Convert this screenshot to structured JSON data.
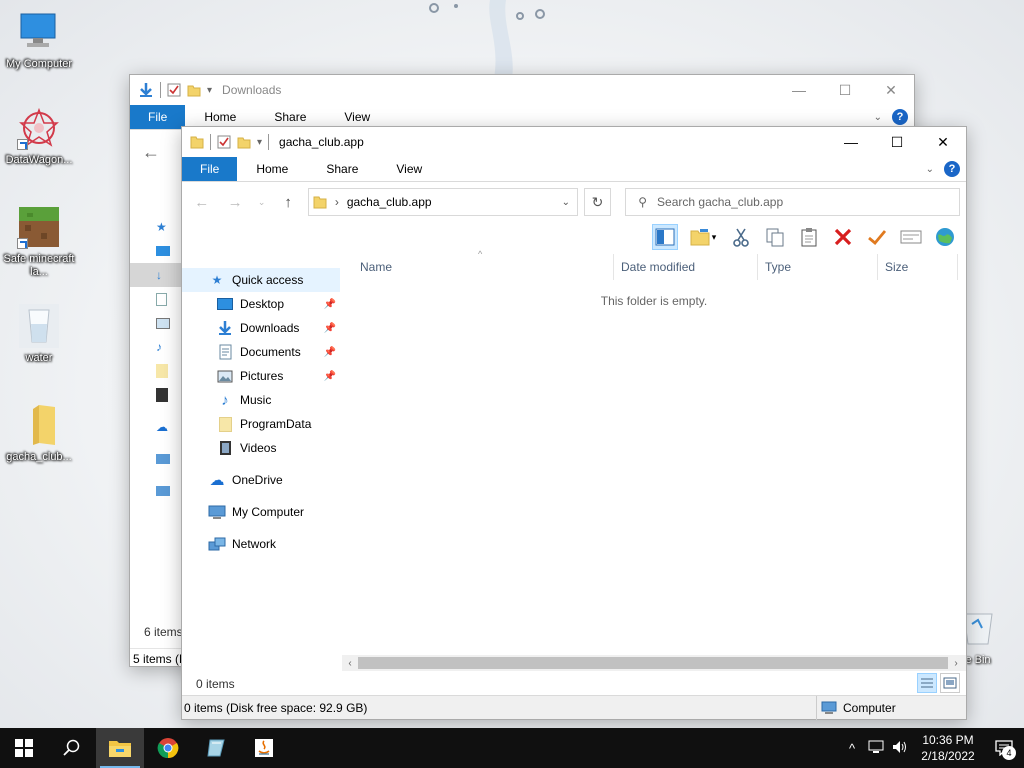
{
  "desktop": {
    "icons": [
      {
        "label": "My Computer",
        "icon": "monitor-icon"
      },
      {
        "label": "DataWagon...",
        "icon": "datawagon-icon"
      },
      {
        "label": "Safe minecraft la...",
        "icon": "minecraft-icon"
      },
      {
        "label": "water",
        "icon": "water-glass-icon"
      },
      {
        "label": "gacha_club...",
        "icon": "folder-icon"
      }
    ],
    "recycle_bin_label": "ycle Bin"
  },
  "back_window": {
    "title": "Downloads",
    "tabs": [
      "File",
      "Home",
      "Share",
      "View"
    ],
    "status_count": "6 items",
    "status_bar": "5 items (D"
  },
  "front_window": {
    "title": "gacha_club.app",
    "tabs": [
      "File",
      "Home",
      "Share",
      "View"
    ],
    "address": "gacha_club.app",
    "search_placeholder": "Search gacha_club.app",
    "sidebar": {
      "quick_access": "Quick access",
      "items": [
        {
          "label": "Desktop",
          "icon": "desktop-icon",
          "pinned": true
        },
        {
          "label": "Downloads",
          "icon": "download-arrow-icon",
          "pinned": true
        },
        {
          "label": "Documents",
          "icon": "documents-icon",
          "pinned": true
        },
        {
          "label": "Pictures",
          "icon": "pictures-icon",
          "pinned": true
        },
        {
          "label": "Music",
          "icon": "music-icon",
          "pinned": false
        },
        {
          "label": "ProgramData",
          "icon": "folder-icon",
          "pinned": false
        },
        {
          "label": "Videos",
          "icon": "videos-icon",
          "pinned": false
        }
      ],
      "onedrive": "OneDrive",
      "computer": "My Computer",
      "network": "Network"
    },
    "columns": [
      "Name",
      "Date modified",
      "Type",
      "Size"
    ],
    "empty_message": "This folder is empty.",
    "items_count": "0 items",
    "status_text": "0 items (Disk free space: 92.9 GB)",
    "status_location": "Computer"
  },
  "taskbar": {
    "time": "10:36 PM",
    "date": "2/18/2022",
    "notification_count": "4"
  },
  "colors": {
    "accent": "#1979ca",
    "taskbar": "#101010",
    "selection": "#cce8ff",
    "delete_red": "#d81e1e",
    "check_orange": "#e07a20"
  }
}
